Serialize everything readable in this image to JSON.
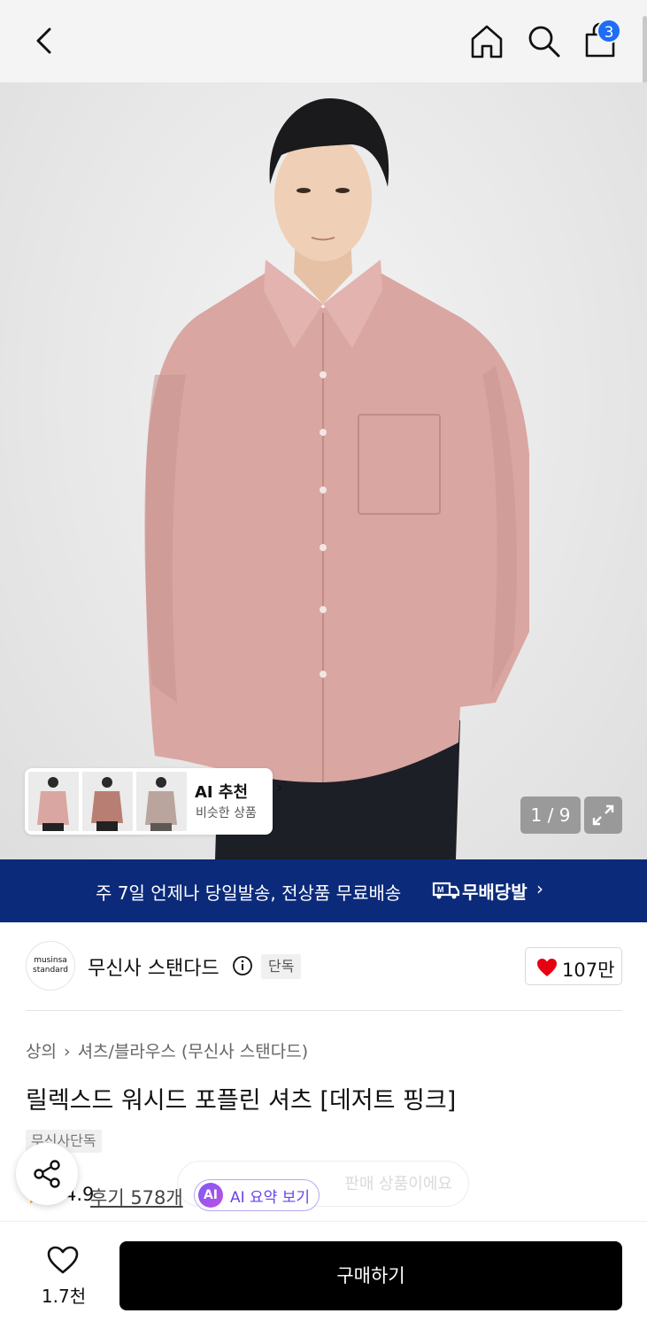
{
  "header": {
    "cart_count": "3"
  },
  "gallery": {
    "counter": "1 / 9",
    "ai_card": {
      "title": "AI 추천",
      "subtitle": "비슷한 상품"
    }
  },
  "banner": {
    "text": "주 7일 언제나 당일발송, 전상품 무료배송",
    "brand": "무배당발"
  },
  "brand": {
    "logo_line1": "musinsa",
    "logo_line2": "standard",
    "name": "무신사 스탠다드",
    "badge": "단독",
    "likes": "107만"
  },
  "product": {
    "breadcrumb": [
      "상의",
      "셔츠/블라우스 (무신사 스탠다드)"
    ],
    "title": "릴렉스드 워시드 포플린 셔츠 [데저트 핑크]",
    "tag": "무신사단독",
    "rating": "4.9",
    "reviews": "후기 578개",
    "ai_summary": "AI 요약 보기",
    "ghost_text": "판매 상품이에요"
  },
  "bottom": {
    "wish_count": "1.7천",
    "buy_label": "구매하기"
  },
  "colors": {
    "accent_blue": "#1f6df5",
    "banner_navy": "#0b2a7a",
    "shirt_pink": "#d9a6a2",
    "heart_red": "#e60012",
    "ai_purple": "#6a43e8"
  }
}
